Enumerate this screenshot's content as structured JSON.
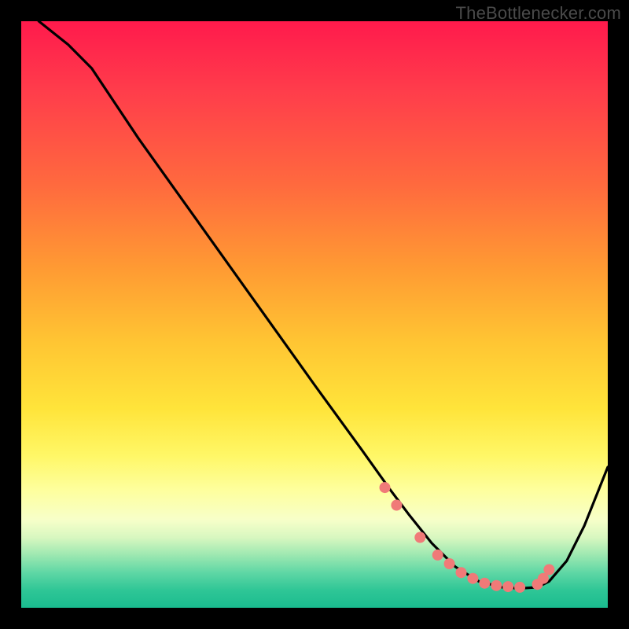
{
  "attribution": "TheBottlenecker.com",
  "colors": {
    "background": "#000000",
    "gradient_top": "#ff1a4c",
    "gradient_bottom": "#1abc8f",
    "line": "#000000",
    "marker": "#f07a78",
    "attribution_text": "#4a4a4a"
  },
  "chart_data": {
    "type": "line",
    "title": "",
    "xlabel": "",
    "ylabel": "",
    "xlim": [
      0,
      100
    ],
    "ylim": [
      0,
      100
    ],
    "grid": false,
    "legend": false,
    "series": [
      {
        "name": "curve",
        "x": [
          0,
          3,
          8,
          12,
          20,
          30,
          40,
          50,
          58,
          63,
          66,
          70,
          74,
          78,
          82,
          85,
          88,
          90,
          93,
          96,
          100
        ],
        "y": [
          104,
          100,
          96,
          92,
          80,
          66,
          52,
          38,
          27,
          20,
          16,
          11,
          7,
          4.5,
          3.5,
          3.3,
          3.5,
          4.5,
          8,
          14,
          24
        ]
      }
    ],
    "markers": {
      "name": "marker-points",
      "x": [
        62,
        64,
        68,
        71,
        73,
        75,
        77,
        79,
        81,
        83,
        85,
        88,
        89,
        90
      ],
      "y": [
        20.5,
        17.5,
        12,
        9,
        7.5,
        6,
        5,
        4.2,
        3.8,
        3.6,
        3.5,
        4,
        5,
        6.5
      ]
    },
    "note": "No axes, ticks, or numeric labels are visible; values are inferred in 0-100 domain from curve geometry against the gradient field."
  }
}
